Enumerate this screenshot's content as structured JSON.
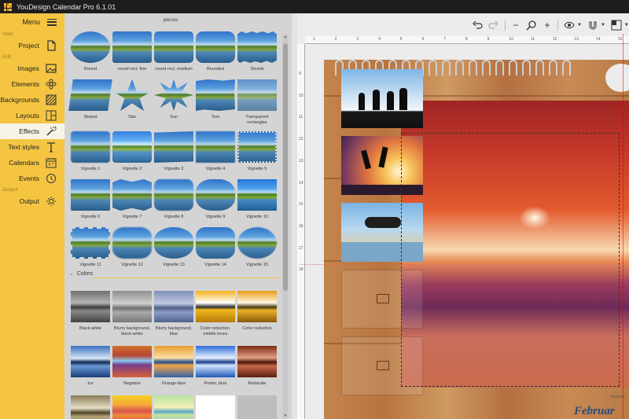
{
  "app": {
    "title": "YouDesign Calendar Pro 6.1.01"
  },
  "sidebar": {
    "menu_label": "Menu",
    "sections": {
      "start": "Start",
      "edit": "Edit",
      "output": "Output"
    },
    "items": [
      {
        "label": "Project",
        "icon": "page-icon"
      },
      {
        "label": "Images",
        "icon": "image-icon"
      },
      {
        "label": "Elements",
        "icon": "flower-icon"
      },
      {
        "label": "Backgrounds",
        "icon": "hatch-icon"
      },
      {
        "label": "Layouts",
        "icon": "layout-icon"
      },
      {
        "label": "Effects",
        "icon": "magic-wand-icon",
        "active": true
      },
      {
        "label": "Text styles",
        "icon": "text-icon"
      },
      {
        "label": "Calendars",
        "icon": "calendar-icon"
      },
      {
        "label": "Events",
        "icon": "clock-icon"
      },
      {
        "label": "Output",
        "icon": "sparkle-icon"
      }
    ]
  },
  "gallery": {
    "top_label": "pieces",
    "shapes": [
      "Round",
      "round rect. fine",
      "round rect. medium",
      "Rounded",
      "Shreds",
      "Sloped",
      "Star",
      "Sun",
      "Torn",
      "Transparent rectangles",
      "Vignette 1",
      "Vignette 2",
      "Vignette 3",
      "Vignette 4",
      "Vignette 5",
      "Vignette 6",
      "Vignette 7",
      "Vignette 8",
      "Vignette 9",
      "Vignette 10",
      "Vignette 11",
      "Vignette 12",
      "Vignette 13",
      "Vignette 14",
      "Vignette 15"
    ],
    "colors_header": "Colors",
    "colors": [
      "Black-white",
      "Blurry background, black-white",
      "Blurry background, blue",
      "Color reduction, middle tones",
      "Color reduction",
      "Ice",
      "Negative",
      "Orange-blue",
      "Poster, blue",
      "Redscale"
    ]
  },
  "toolbar": {
    "icons": [
      "undo-icon",
      "redo-icon",
      "zoom-out-icon",
      "zoom-icon",
      "zoom-in-icon",
      "eye-icon",
      "magnet-icon",
      "grid-icon",
      "more-icon"
    ],
    "zoom_out": "−",
    "zoom_in": "+"
  },
  "ruler": {
    "h_ticks": [
      "1",
      "2",
      "3",
      "4",
      "5",
      "6",
      "7",
      "8",
      "9",
      "10",
      "11",
      "12",
      "13",
      "14",
      "15"
    ],
    "v_ticks": [
      "9",
      "10",
      "11",
      "12",
      "13",
      "14",
      "15",
      "16",
      "17",
      "18"
    ]
  },
  "canvas": {
    "month_label": "Februar",
    "events_label": "Events"
  }
}
